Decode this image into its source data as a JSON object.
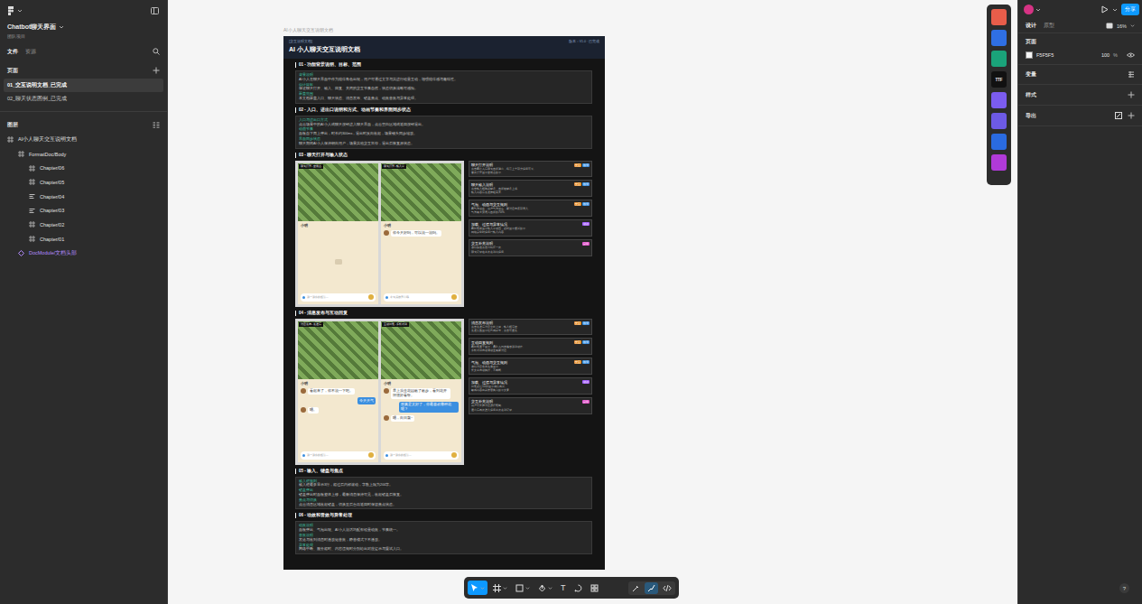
{
  "sidebar": {
    "file_title": "Chatbot聊天界面",
    "file_subtitle": "团队项目",
    "tabs": [
      {
        "label": "文件",
        "selected": true
      },
      {
        "label": "资源",
        "selected": false
      }
    ],
    "pages_header": "页面",
    "pages": [
      {
        "label": "01_交互说明文档_已完成",
        "selected": true
      },
      {
        "label": "02_聊天状态图例_已完成",
        "selected": false
      }
    ],
    "layers_header": "图层",
    "layers": [
      {
        "label": "AI小人聊天交互说明文档",
        "depth": 0,
        "kind": "frame"
      },
      {
        "label": "FormatDoc/Body",
        "depth": 1,
        "kind": "frame"
      },
      {
        "label": "Chapter/06",
        "depth": 2,
        "kind": "frame"
      },
      {
        "label": "Chapter/05",
        "depth": 2,
        "kind": "frame"
      },
      {
        "label": "Chapter/04",
        "depth": 2,
        "kind": "autolayout"
      },
      {
        "label": "Chapter/03",
        "depth": 2,
        "kind": "autolayout"
      },
      {
        "label": "Chapter/02",
        "depth": 2,
        "kind": "frame"
      },
      {
        "label": "Chapter/01",
        "depth": 2,
        "kind": "frame"
      },
      {
        "label": "DocModule/文档头部",
        "depth": 1,
        "kind": "component"
      }
    ]
  },
  "canvas": {
    "frame_label": "AI小人聊天交互说明文档",
    "doc": {
      "tag": "[交互说明文档]",
      "meta": "版本：V1.0 · 已完成",
      "title": "AI 小人聊天交互说明文档",
      "sections": [
        {
          "heading": "01 - 功能背景说明、目标、范围",
          "kind": "text",
          "items": [
            {
              "label": "背景说明",
              "text": "AI小人在聊天界面中作为陪伴角色出现，用户可通过文字与其进行轻量互动，增强陪伴感与趣味性。"
            },
            {
              "label": "设计目标",
              "text": "保证聊天打开、输入、回复、关闭的交互节奏自然，状态切换清晰可感知。"
            },
            {
              "label": "覆盖范围",
              "text": "本文档覆盖入口、聊天状态、消息发布、键盘焦点、动效音效与异常处理。"
            }
          ]
        },
        {
          "heading": "02 - 入口、进出口说明和方式、动画节奏和界面同步状态",
          "kind": "text",
          "items": [
            {
              "label": "入口与进出口方式",
              "text": "点击场景中的AI小人或聊天按钮进入聊天界面，点击空白区域或返回按钮退出。"
            },
            {
              "label": "动画节奏",
              "text": "面板自下而上弹出，时长约300ms，退出时反向收起，场景镜头同步缩放。"
            },
            {
              "label": "界面同步状态",
              "text": "聊天期间AI小人保持朝向用户，场景其他交互暂停，退出后恢复原状态。"
            }
          ]
        },
        {
          "heading": "03 - 聊天打开与输入状态",
          "kind": "screens",
          "phones": [
            {
              "caption": "聊天打开 - 空状态",
              "name": "小明",
              "messages": [],
              "input": "说一说你的想法..."
            },
            {
              "caption": "聊天打开 - 输入中",
              "name": "小明",
              "messages": [
                {
                  "from": "bot",
                  "text": "你今天好吗，可以说一说吗。"
                }
              ],
              "input": "今天我很开心哦"
            }
          ],
          "notes": [
            {
              "title": "聊天打开说明",
              "tags": [
                {
                  "label": "交互",
                  "color": "#e8912d"
                },
                {
                  "label": "视觉",
                  "color": "#3b8fe0"
                }
              ],
              "lines": [
                "点击AI小人后聊天面板弹出，场景上半部分保留可见。",
                "首次打开显示空状态提示。"
              ]
            },
            {
              "title": "聊天输入说明",
              "tags": [
                {
                  "label": "交互",
                  "color": "#e8912d"
                },
                {
                  "label": "视觉",
                  "color": "#3b8fe0"
                }
              ],
              "lines": [
                "点击输入框唤起键盘，面板随键盘上移。",
                "输入内容后发送按钮高亮。"
              ]
            },
            {
              "title": "气泡、动画与交互规则",
              "tags": [
                {
                  "label": "交互",
                  "color": "#e8912d"
                },
                {
                  "label": "视觉",
                  "color": "#3b8fe0"
                }
              ],
              "lines": [
                "AI气泡居左，用户气泡居右，新消息自底部滑入。",
                "气泡最大宽度为面板的70%。"
              ]
            },
            {
              "title": "加载、过渡与异常情况",
              "tags": [
                {
                  "label": "动效",
                  "color": "#a259ff"
                }
              ],
              "lines": [
                "AI回复前显示输入中动画，超时显示重试提示。",
                "网络异常时保留已输入内容。"
              ]
            },
            {
              "title": "交互补充说明",
              "tags": [
                {
                  "label": "异常",
                  "color": "#e04fc8"
                }
              ],
              "lines": [
                "连续快速点击只响应一次。",
                "聊天记录在本次会话内保留。"
              ]
            }
          ]
        },
        {
          "heading": "04 - 消息发布与互动回复",
          "kind": "screens",
          "phones": [
            {
              "caption": "消息发布 - 发送后",
              "name": "小明",
              "messages": [
                {
                  "from": "bot",
                  "text": "看起来了，你不说一下吧。"
                },
                {
                  "from": "user",
                  "text": "今天天气"
                },
                {
                  "from": "bot",
                  "text": "嗯。"
                }
              ],
              "input": "说一说你的想法..."
            },
            {
              "caption": "互动回复 - 多轮对话",
              "name": "小明",
              "messages": [
                {
                  "from": "bot",
                  "text": "早上我去花园散了散步，看到花开得很好看呀。"
                },
                {
                  "from": "user",
                  "text": "那真是太好了，你最喜欢哪种花呢？"
                },
                {
                  "from": "bot",
                  "text": "嗯，向日葵~"
                }
              ],
              "input": "说一说你的想法..."
            }
          ],
          "notes": [
            {
              "title": "消息发布说明",
              "tags": [
                {
                  "label": "交互",
                  "color": "#e8912d"
                },
                {
                  "label": "视觉",
                  "color": "#3b8fe0"
                }
              ],
              "lines": [
                "点击发送后消息立即上屏，输入框清空。",
                "发送失败显示红色感叹号，点击可重发。"
              ]
            },
            {
              "title": "互动回复规则",
              "tags": [
                {
                  "label": "交互",
                  "color": "#e8912d"
                },
                {
                  "label": "视觉",
                  "color": "#3b8fe0"
                }
              ],
              "lines": [
                "AI回复逐字显示，AI小人同步播放说话动作。",
                "多轮对话自动滚动至最新消息。"
              ]
            },
            {
              "title": "气泡、动画与交互规则",
              "tags": [
                {
                  "label": "交互",
                  "color": "#e8912d"
                },
                {
                  "label": "视觉",
                  "color": "#3b8fe0"
                }
              ],
              "lines": [
                "连续消息合并头像显示。",
                "长文本自动换行，不截断。"
              ]
            },
            {
              "title": "加载、过渡与异常情况",
              "tags": [
                {
                  "label": "动效",
                  "color": "#a259ff"
                }
              ],
              "lines": [
                "回复超过10秒显示稍后再试。",
                "敏感内容由系统替换为提示文案。"
              ]
            },
            {
              "title": "交互补充说明",
              "tags": [
                {
                  "label": "异常",
                  "color": "#e04fc8"
                }
              ],
              "lines": [
                "用户可长按消息进行复制。",
                "退出后再次进入保留本次会话记录。"
              ]
            }
          ]
        },
        {
          "heading": "05 - 输入、键盘与焦点",
          "kind": "text",
          "items": [
            {
              "label": "输入框规则",
              "text": "输入框最多显示3行，超过后内部滚动，字数上限为200字。"
            },
            {
              "label": "键盘弹出",
              "text": "键盘弹出时面板整体上移，最新消息保持可见，收起键盘后恢复。"
            },
            {
              "label": "焦点与切换",
              "text": "点击消息区域收起键盘，切换至后台再返回时保留焦点状态。"
            }
          ]
        },
        {
          "heading": "06 - 动效和音效与异常处理",
          "kind": "text",
          "items": [
            {
              "label": "动效说明",
              "text": "面板弹出、气泡出现、AI小人说话均配有轻量动效，节奏统一。"
            },
            {
              "label": "音效说明",
              "text": "发送与收到消息时播放短音效，静音模式下不播放。"
            },
            {
              "label": "异常处理",
              "text": "网络中断、服务超时、内容违规时分别给出对应提示与重试入口。"
            }
          ]
        }
      ]
    }
  },
  "plugins": [
    {
      "color": "#e85d4a",
      "label": ""
    },
    {
      "color": "#2f6fe4",
      "label": ""
    },
    {
      "color": "#1aa37a",
      "label": ""
    },
    {
      "color": "#111111",
      "label": "TTF"
    },
    {
      "color": "#7b5cf0",
      "label": ""
    },
    {
      "color": "#6d5ae6",
      "label": ""
    },
    {
      "color": "#2a6be0",
      "label": ""
    },
    {
      "color": "#b03ad8",
      "label": ""
    }
  ],
  "toolbar": {
    "tools": [
      {
        "kind": "move",
        "selected": true,
        "glyph": ""
      },
      {
        "kind": "frame",
        "selected": false,
        "glyph": ""
      },
      {
        "kind": "rect",
        "selected": false,
        "glyph": ""
      },
      {
        "kind": "pen",
        "selected": false,
        "glyph": ""
      },
      {
        "kind": "text",
        "selected": false,
        "glyph": "T"
      },
      {
        "kind": "comment",
        "selected": false,
        "glyph": ""
      },
      {
        "kind": "components",
        "selected": false,
        "glyph": ""
      }
    ],
    "modes": [
      {
        "kind": "draw",
        "selected": false
      },
      {
        "kind": "design",
        "selected": true
      },
      {
        "kind": "dev",
        "selected": false
      }
    ]
  },
  "right_panel": {
    "share": "分享",
    "tabs": [
      {
        "label": "设计",
        "selected": true
      },
      {
        "label": "原型",
        "selected": false
      }
    ],
    "zoom": "16%",
    "page_section": "页面",
    "swatch": "#F5F5F5",
    "color_value": "F5F5F5",
    "opacity": "100",
    "unit": "%",
    "sections": [
      "变量",
      "样式",
      "导出"
    ],
    "help": "?"
  }
}
